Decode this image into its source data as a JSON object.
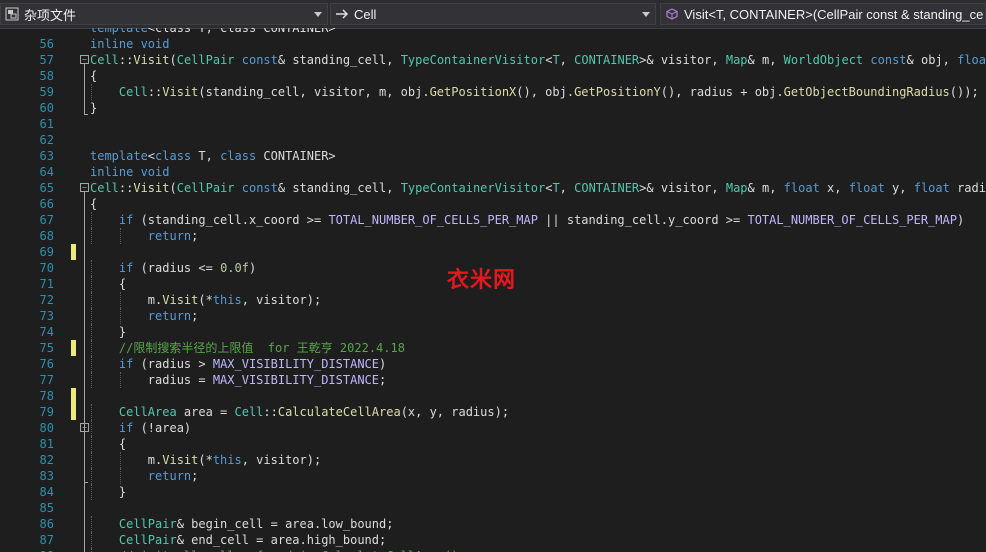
{
  "navbar": {
    "project": {
      "label": "杂项文件",
      "icon": "project-file-icon"
    },
    "scope": {
      "label": "Cell",
      "icon": "arrow-right-icon"
    },
    "member": {
      "label": "Visit<T, CONTAINER>(CellPair const & standing_ce",
      "icon": "method-cube-icon"
    },
    "dropdown_icon": "chevron-down-icon"
  },
  "watermark": "衣米网",
  "colors": {
    "background": "#1e1e1e",
    "line_number": "#2b91af",
    "keyword": "#569cd6",
    "type": "#4ec9b0",
    "macro": "#beb7ff",
    "function": "#dcdcaa",
    "comment": "#57a64a",
    "number": "#b5cea8",
    "change_marker": "#efe97c"
  },
  "code_lines": [
    {
      "num": "",
      "changed": false,
      "fold": false,
      "tokens": [
        [
          "kw",
          "template"
        ],
        [
          "tx",
          "<class T, class CONTAINER>"
        ]
      ]
    },
    {
      "num": "56",
      "changed": false,
      "fold": false,
      "tokens": [
        [
          "kw",
          "inline void"
        ]
      ]
    },
    {
      "num": "57",
      "changed": false,
      "fold": true,
      "tokens": [
        [
          "ty",
          "Cell"
        ],
        [
          "tx",
          "::"
        ],
        [
          "fn",
          "Visit"
        ],
        [
          "tx",
          "("
        ],
        [
          "ty",
          "CellPair"
        ],
        [
          "tx",
          " "
        ],
        [
          "kw",
          "const"
        ],
        [
          "tx",
          "& standing_cell, "
        ],
        [
          "ty",
          "TypeContainerVisitor"
        ],
        [
          "tx",
          "<"
        ],
        [
          "ty",
          "T"
        ],
        [
          "tx",
          ", "
        ],
        [
          "ty",
          "CONTAINER"
        ],
        [
          "tx",
          ">& visitor, "
        ],
        [
          "ty",
          "Map"
        ],
        [
          "tx",
          "& m, "
        ],
        [
          "ty",
          "WorldObject"
        ],
        [
          "tx",
          " "
        ],
        [
          "kw",
          "const"
        ],
        [
          "tx",
          "& obj, "
        ],
        [
          "kw",
          "float"
        ],
        [
          "tx",
          " ra"
        ]
      ]
    },
    {
      "num": "58",
      "changed": false,
      "fold": false,
      "tokens": [
        [
          "tx",
          "{"
        ]
      ]
    },
    {
      "num": "59",
      "changed": false,
      "fold": false,
      "tokens": [
        [
          "tx",
          "    "
        ],
        [
          "ty",
          "Cell"
        ],
        [
          "tx",
          "::"
        ],
        [
          "fn",
          "Visit"
        ],
        [
          "tx",
          "(standing_cell, visitor, m, obj."
        ],
        [
          "fn",
          "GetPositionX"
        ],
        [
          "tx",
          "(), obj."
        ],
        [
          "fn",
          "GetPositionY"
        ],
        [
          "tx",
          "(), radius + obj."
        ],
        [
          "fn",
          "GetObjectBoundingRadius"
        ],
        [
          "tx",
          "());"
        ]
      ]
    },
    {
      "num": "60",
      "changed": false,
      "fold": false,
      "tokens": [
        [
          "tx",
          "}"
        ]
      ]
    },
    {
      "num": "61",
      "changed": false,
      "fold": false,
      "tokens": []
    },
    {
      "num": "62",
      "changed": false,
      "fold": false,
      "tokens": []
    },
    {
      "num": "63",
      "changed": false,
      "fold": false,
      "tokens": [
        [
          "kw",
          "template"
        ],
        [
          "tx",
          "<"
        ],
        [
          "kw",
          "class"
        ],
        [
          "tx",
          " T, "
        ],
        [
          "kw",
          "class"
        ],
        [
          "tx",
          " CONTAINER>"
        ]
      ]
    },
    {
      "num": "64",
      "changed": false,
      "fold": false,
      "tokens": [
        [
          "kw",
          "inline void"
        ]
      ]
    },
    {
      "num": "65",
      "changed": false,
      "fold": true,
      "tokens": [
        [
          "ty",
          "Cell"
        ],
        [
          "tx",
          "::"
        ],
        [
          "fn",
          "Visit"
        ],
        [
          "tx",
          "("
        ],
        [
          "ty",
          "CellPair"
        ],
        [
          "tx",
          " "
        ],
        [
          "kw",
          "const"
        ],
        [
          "tx",
          "& standing_cell, "
        ],
        [
          "ty",
          "TypeContainerVisitor"
        ],
        [
          "tx",
          "<"
        ],
        [
          "ty",
          "T"
        ],
        [
          "tx",
          ", "
        ],
        [
          "ty",
          "CONTAINER"
        ],
        [
          "tx",
          ">& visitor, "
        ],
        [
          "ty",
          "Map"
        ],
        [
          "tx",
          "& m, "
        ],
        [
          "kw",
          "float"
        ],
        [
          "tx",
          " x, "
        ],
        [
          "kw",
          "float"
        ],
        [
          "tx",
          " y, "
        ],
        [
          "kw",
          "float"
        ],
        [
          "tx",
          " radius)"
        ]
      ]
    },
    {
      "num": "66",
      "changed": false,
      "fold": false,
      "tokens": [
        [
          "tx",
          "{"
        ]
      ]
    },
    {
      "num": "67",
      "changed": false,
      "fold": false,
      "tokens": [
        [
          "tx",
          "    "
        ],
        [
          "kw",
          "if"
        ],
        [
          "tx",
          " (standing_cell.x_coord >= "
        ],
        [
          "mc",
          "TOTAL_NUMBER_OF_CELLS_PER_MAP"
        ],
        [
          "tx",
          " || standing_cell.y_coord >= "
        ],
        [
          "mc",
          "TOTAL_NUMBER_OF_CELLS_PER_MAP"
        ],
        [
          "tx",
          ")"
        ]
      ]
    },
    {
      "num": "68",
      "changed": false,
      "fold": false,
      "tokens": [
        [
          "tx",
          "        "
        ],
        [
          "kw",
          "return"
        ],
        [
          "tx",
          ";"
        ]
      ]
    },
    {
      "num": "69",
      "changed": true,
      "fold": false,
      "tokens": []
    },
    {
      "num": "70",
      "changed": false,
      "fold": false,
      "tokens": [
        [
          "tx",
          "    "
        ],
        [
          "kw",
          "if"
        ],
        [
          "tx",
          " (radius <= "
        ],
        [
          "nm",
          "0.0f"
        ],
        [
          "tx",
          ")"
        ]
      ]
    },
    {
      "num": "71",
      "changed": false,
      "fold": false,
      "tokens": [
        [
          "tx",
          "    {"
        ]
      ]
    },
    {
      "num": "72",
      "changed": false,
      "fold": false,
      "tokens": [
        [
          "tx",
          "        m."
        ],
        [
          "fn",
          "Visit"
        ],
        [
          "tx",
          "(*"
        ],
        [
          "kw",
          "this"
        ],
        [
          "tx",
          ", visitor);"
        ]
      ]
    },
    {
      "num": "73",
      "changed": false,
      "fold": false,
      "tokens": [
        [
          "tx",
          "        "
        ],
        [
          "kw",
          "return"
        ],
        [
          "tx",
          ";"
        ]
      ]
    },
    {
      "num": "74",
      "changed": false,
      "fold": false,
      "tokens": [
        [
          "tx",
          "    }"
        ]
      ]
    },
    {
      "num": "75",
      "changed": true,
      "fold": false,
      "tokens": [
        [
          "tx",
          "    "
        ],
        [
          "cm",
          "//限制搜索半径的上限值  for 王乾亨 2022.4.18"
        ]
      ]
    },
    {
      "num": "76",
      "changed": false,
      "fold": false,
      "tokens": [
        [
          "tx",
          "    "
        ],
        [
          "kw",
          "if"
        ],
        [
          "tx",
          " (radius > "
        ],
        [
          "mc",
          "MAX_VISIBILITY_DISTANCE"
        ],
        [
          "tx",
          ")"
        ]
      ]
    },
    {
      "num": "77",
      "changed": false,
      "fold": false,
      "tokens": [
        [
          "tx",
          "        radius = "
        ],
        [
          "mc",
          "MAX_VISIBILITY_DISTANCE"
        ],
        [
          "tx",
          ";"
        ]
      ]
    },
    {
      "num": "78",
      "changed": true,
      "fold": false,
      "tokens": []
    },
    {
      "num": "79",
      "changed": true,
      "fold": false,
      "tokens": [
        [
          "tx",
          "    "
        ],
        [
          "ty",
          "CellArea"
        ],
        [
          "tx",
          " area = "
        ],
        [
          "ty",
          "Cell"
        ],
        [
          "tx",
          "::"
        ],
        [
          "fn",
          "CalculateCellArea"
        ],
        [
          "tx",
          "(x, y, radius);"
        ]
      ]
    },
    {
      "num": "80",
      "changed": false,
      "fold": true,
      "tokens": [
        [
          "tx",
          "    "
        ],
        [
          "kw",
          "if"
        ],
        [
          "tx",
          " (!area)"
        ]
      ]
    },
    {
      "num": "81",
      "changed": false,
      "fold": false,
      "tokens": [
        [
          "tx",
          "    {"
        ]
      ]
    },
    {
      "num": "82",
      "changed": false,
      "fold": false,
      "tokens": [
        [
          "tx",
          "        m."
        ],
        [
          "fn",
          "Visit"
        ],
        [
          "tx",
          "(*"
        ],
        [
          "kw",
          "this"
        ],
        [
          "tx",
          ", visitor);"
        ]
      ]
    },
    {
      "num": "83",
      "changed": false,
      "fold": false,
      "tokens": [
        [
          "tx",
          "        "
        ],
        [
          "kw",
          "return"
        ],
        [
          "tx",
          ";"
        ]
      ]
    },
    {
      "num": "84",
      "changed": false,
      "fold": false,
      "tokens": [
        [
          "tx",
          "    }"
        ]
      ]
    },
    {
      "num": "85",
      "changed": false,
      "fold": false,
      "tokens": []
    },
    {
      "num": "86",
      "changed": false,
      "fold": false,
      "tokens": [
        [
          "tx",
          "    "
        ],
        [
          "ty",
          "CellPair"
        ],
        [
          "tx",
          "& begin_cell = area.low_bound;"
        ]
      ]
    },
    {
      "num": "87",
      "changed": false,
      "fold": false,
      "tokens": [
        [
          "tx",
          "    "
        ],
        [
          "ty",
          "CellPair"
        ],
        [
          "tx",
          "& end_cell = area.high_bound;"
        ]
      ]
    },
    {
      "num": "88",
      "changed": false,
      "fold": false,
      "tokens": [
        [
          "tx",
          "    "
        ],
        [
          "cm",
          "//visit all cells, found in CalculateCellArea()"
        ]
      ]
    }
  ]
}
